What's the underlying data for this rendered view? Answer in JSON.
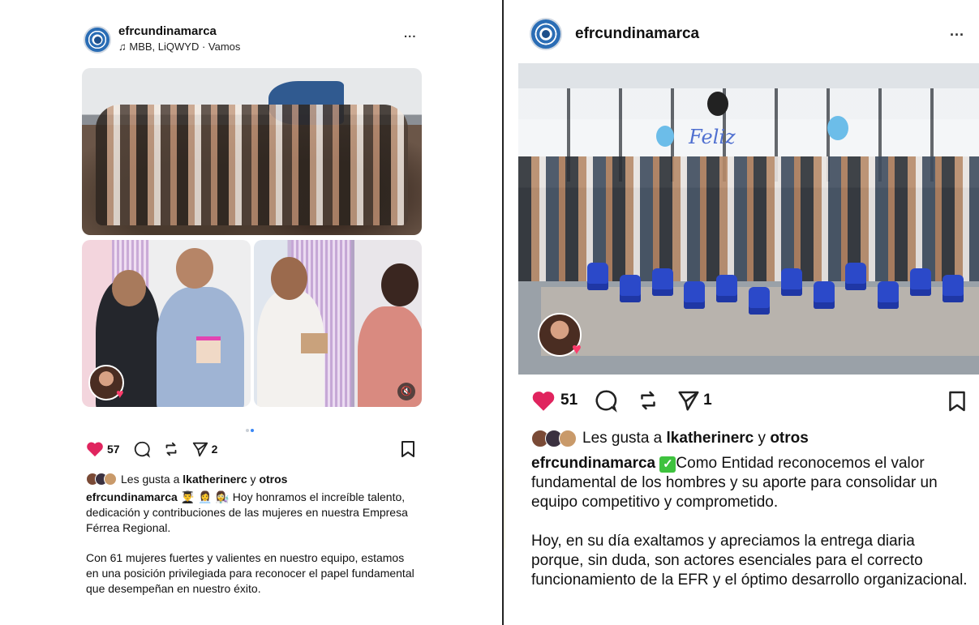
{
  "left_post": {
    "username": "efrcundinamarca",
    "music_icon": "music-note-icon",
    "music_text": "MBB, LiQWYD · Vamos",
    "more_label": "...",
    "likes_count": "57",
    "shares_count": "2",
    "liked_by_prefix": "Les gusta a",
    "liked_by_user": "lkatherinerc",
    "liked_by_join": "y",
    "liked_by_others": "otros",
    "caption_username": "efrcundinamarca",
    "caption_emojis": "👨‍🎓 👩‍💼 👩‍🔬",
    "caption_line1": "Hoy honramos el increíble talento, dedicación y contribuciones de las mujeres en nuestra Empresa Férrea Regional.",
    "caption_para2": "Con 61 mujeres fuertes y valientes en nuestro equipo, estamos en una posición privilegiada para reconocer el papel fundamental que desempeñan en nuestro éxito.",
    "carousel_dots": 2,
    "carousel_active": 1
  },
  "right_post": {
    "username": "efrcundinamarca",
    "more_label": "...",
    "likes_count": "51",
    "shares_count": "1",
    "liked_by_prefix": "Les gusta a",
    "liked_by_user": "lkatherinerc",
    "liked_by_join": "y",
    "liked_by_others": "otros",
    "caption_username": "efrcundinamarca",
    "check_emoji": "✓",
    "caption_line1": "Como Entidad reconocemos el valor fundamental de los hombres y su aporte para consolidar un equipo competitivo y comprometido.",
    "caption_para2": "Hoy, en su día exaltamos y apreciamos la entrega diaria porque, sin duda, son actores esenciales para el correcto funcionamiento de la EFR y el óptimo desarrollo organizacional.",
    "balloon_text": "Feliz"
  },
  "colors": {
    "like_red": "#e0245e",
    "accent_blue": "#3a87f5",
    "gift_blue": "#2b49c9"
  }
}
